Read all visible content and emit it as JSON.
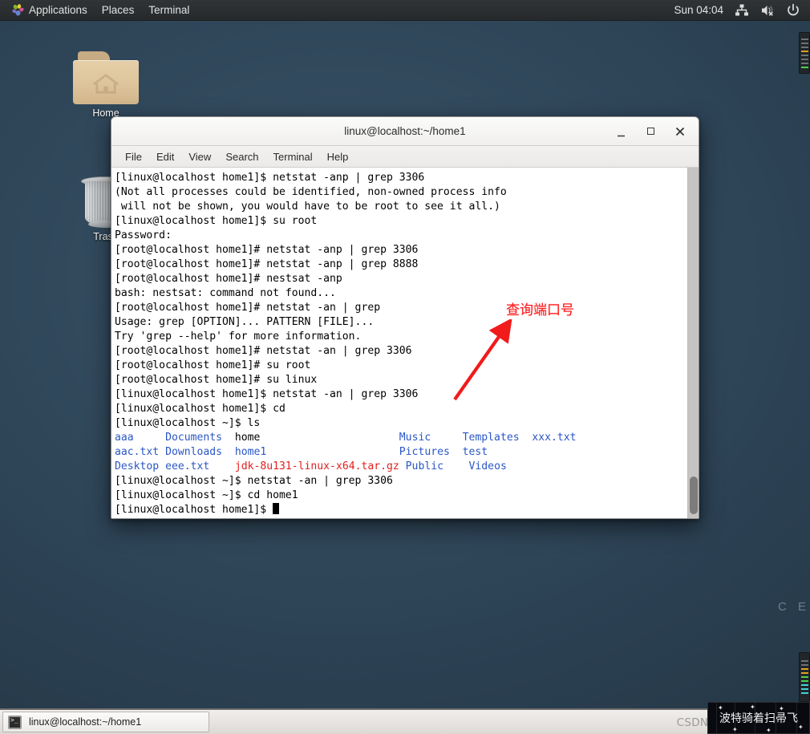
{
  "top_panel": {
    "applications_label": "Applications",
    "places_label": "Places",
    "terminal_label": "Terminal",
    "clock": "Sun 04:04",
    "icons": [
      "network-icon",
      "volume-muted-icon",
      "power-icon"
    ]
  },
  "desktop": {
    "icons": [
      {
        "name": "home-folder",
        "label": "Home",
        "icon": "folder-home-icon"
      },
      {
        "name": "trash",
        "label": "Trash",
        "icon": "trash-icon"
      }
    ]
  },
  "terminal": {
    "title": "linux@localhost:~/home1",
    "menu": [
      "File",
      "Edit",
      "View",
      "Search",
      "Terminal",
      "Help"
    ],
    "window_buttons": {
      "minimize": "minimize-button",
      "maximize": "maximize-button",
      "close": "close-button"
    },
    "lines": [
      [
        {
          "t": "[linux@localhost home1]$ netstat -anp | grep 3306",
          "c": "black"
        }
      ],
      [
        {
          "t": "(Not all processes could be identified, non-owned process info",
          "c": "black"
        }
      ],
      [
        {
          "t": " will not be shown, you would have to be root to see it all.)",
          "c": "black"
        }
      ],
      [
        {
          "t": "[linux@localhost home1]$ su root",
          "c": "black"
        }
      ],
      [
        {
          "t": "Password:",
          "c": "black"
        }
      ],
      [
        {
          "t": "[root@localhost home1]# netstat -anp | grep 3306",
          "c": "black"
        }
      ],
      [
        {
          "t": "[root@localhost home1]# netstat -anp | grep 8888",
          "c": "black"
        }
      ],
      [
        {
          "t": "[root@localhost home1]# nestsat -anp",
          "c": "black"
        }
      ],
      [
        {
          "t": "bash: nestsat: command not found...",
          "c": "black"
        }
      ],
      [
        {
          "t": "[root@localhost home1]# netstat -an | grep",
          "c": "black"
        }
      ],
      [
        {
          "t": "Usage: grep [OPTION]... PATTERN [FILE]...",
          "c": "black"
        }
      ],
      [
        {
          "t": "Try 'grep --help' for more information.",
          "c": "black"
        }
      ],
      [
        {
          "t": "[root@localhost home1]# netstat -an | grep 3306",
          "c": "black"
        }
      ],
      [
        {
          "t": "[root@localhost home1]# su root",
          "c": "black"
        }
      ],
      [
        {
          "t": "[root@localhost home1]# su linux",
          "c": "black"
        }
      ],
      [
        {
          "t": "[linux@localhost home1]$ netstat -an | grep 3306",
          "c": "black"
        }
      ],
      [
        {
          "t": "[linux@localhost home1]$ cd",
          "c": "black"
        }
      ],
      [
        {
          "t": "[linux@localhost ~]$ ls",
          "c": "black"
        }
      ],
      [
        {
          "t": "aaa",
          "c": "blue"
        },
        {
          "t": "     ",
          "c": "black"
        },
        {
          "t": "Documents",
          "c": "blue"
        },
        {
          "t": "  ",
          "c": "black"
        },
        {
          "t": "home",
          "c": "black"
        },
        {
          "t": "                      ",
          "c": "black"
        },
        {
          "t": "Music",
          "c": "blue"
        },
        {
          "t": "     ",
          "c": "black"
        },
        {
          "t": "Templates",
          "c": "blue"
        },
        {
          "t": "  ",
          "c": "black"
        },
        {
          "t": "xxx.txt",
          "c": "blue"
        }
      ],
      [
        {
          "t": "aac.txt",
          "c": "blue"
        },
        {
          "t": " ",
          "c": "black"
        },
        {
          "t": "Downloads",
          "c": "blue"
        },
        {
          "t": "  ",
          "c": "black"
        },
        {
          "t": "home1",
          "c": "blue"
        },
        {
          "t": "                     ",
          "c": "black"
        },
        {
          "t": "Pictures",
          "c": "blue"
        },
        {
          "t": "  ",
          "c": "black"
        },
        {
          "t": "test",
          "c": "blue"
        }
      ],
      [
        {
          "t": "Desktop",
          "c": "blue"
        },
        {
          "t": " ",
          "c": "black"
        },
        {
          "t": "eee.txt",
          "c": "blue"
        },
        {
          "t": "    ",
          "c": "black"
        },
        {
          "t": "jdk-8u131-linux-x64.tar.gz",
          "c": "red"
        },
        {
          "t": " ",
          "c": "black"
        },
        {
          "t": "Public",
          "c": "blue"
        },
        {
          "t": "    ",
          "c": "black"
        },
        {
          "t": "Videos",
          "c": "blue"
        }
      ],
      [
        {
          "t": "[linux@localhost ~]$ netstat -an | grep 3306",
          "c": "black"
        }
      ],
      [
        {
          "t": "[linux@localhost ~]$ cd home1",
          "c": "black"
        }
      ],
      [
        {
          "t": "[linux@localhost home1]$ ",
          "c": "black",
          "cursor": true
        }
      ]
    ]
  },
  "annotation": {
    "text": "查询端口号",
    "color": "#ff1a1a",
    "arrow": "red-arrow-pointer"
  },
  "taskbar": {
    "task_label": "linux@localhost:~/home1",
    "task_icon": "terminal-icon"
  },
  "watermark": {
    "text": "CSDN @░░ ░░░░哈利"
  },
  "night_widget": {
    "text": "波特骑着扫帚飞"
  },
  "edge_text": "C E",
  "colors": {
    "desktop_bg": "#2e4558",
    "panel_bg": "#2b2f31",
    "terminal_bg": "#ffffff",
    "terminal_fg": "#000000",
    "ls_dir": "#2a56c6",
    "ls_archive": "#e22020",
    "annotation": "#ff1a1a"
  }
}
